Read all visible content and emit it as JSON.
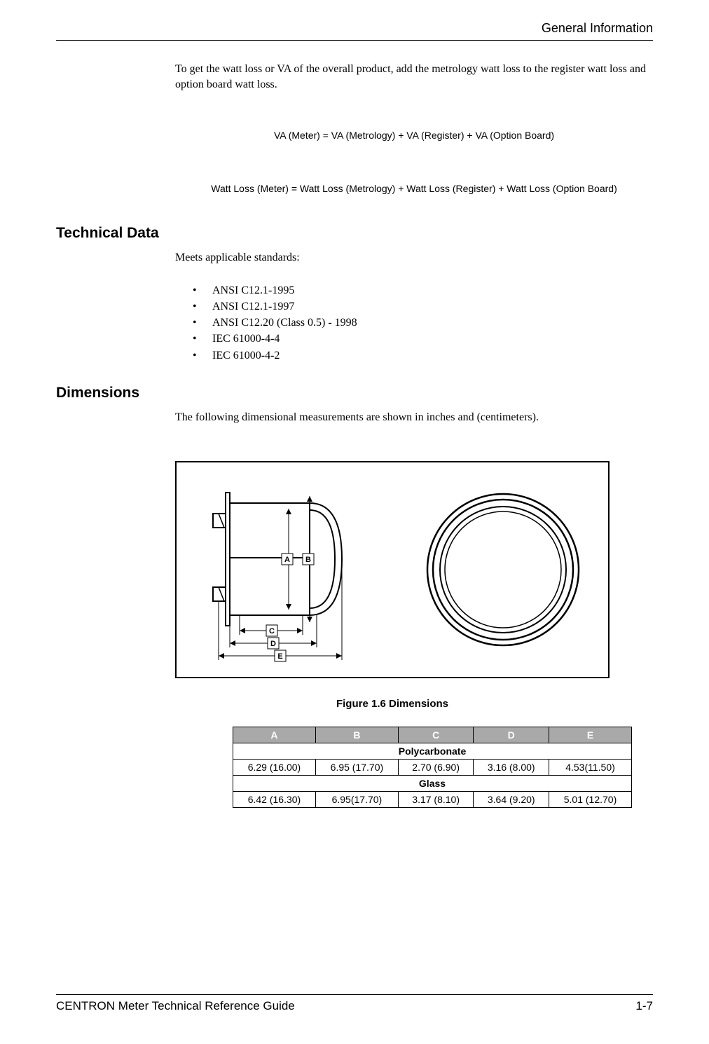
{
  "header": {
    "section": "General Information"
  },
  "intro": {
    "text": "To get the watt loss or VA of the overall product, add the metrology watt loss to the register watt loss and option board watt loss."
  },
  "equations": {
    "va": "VA (Meter)  =  VA (Metrology) + VA (Register) + VA (Option Board)",
    "wattloss": "Watt Loss (Meter)  =  Watt Loss (Metrology) + Watt Loss (Register) + Watt Loss (Option Board)"
  },
  "technical_data": {
    "heading": "Technical Data",
    "intro": "Meets applicable standards:",
    "standards": [
      "ANSI C12.1-1995",
      "ANSI C12.1-1997",
      "ANSI C12.20 (Class 0.5) - 1998",
      "IEC 61000-4-4",
      "IEC 61000-4-2"
    ]
  },
  "dimensions": {
    "heading": "Dimensions",
    "intro": "The following dimensional measurements are shown in inches and (centimeters).",
    "figure_labels": {
      "A": "A",
      "B": "B",
      "C": "C",
      "D": "D",
      "E": "E"
    },
    "figure_caption": "Figure 1.6   Dimensions",
    "table": {
      "headers": [
        "A",
        "B",
        "C",
        "D",
        "E"
      ],
      "groups": [
        {
          "label": "Polycarbonate",
          "values": [
            "6.29 (16.00)",
            "6.95 (17.70)",
            "2.70 (6.90)",
            "3.16 (8.00)",
            "4.53(11.50)"
          ]
        },
        {
          "label": "Glass",
          "values": [
            "6.42 (16.30)",
            "6.95(17.70)",
            "3.17 (8.10)",
            "3.64 (9.20)",
            "5.01 (12.70)"
          ]
        }
      ]
    }
  },
  "footer": {
    "doc_title": "CENTRON Meter Technical Reference Guide",
    "page": "1-7"
  }
}
